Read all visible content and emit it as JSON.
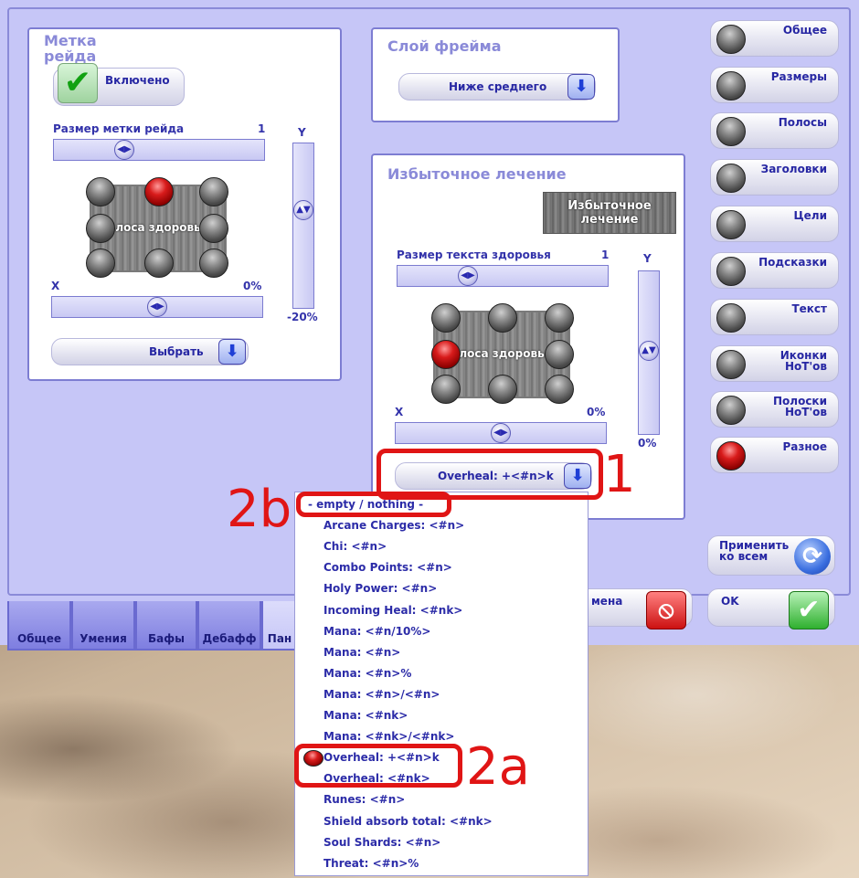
{
  "tabs": [
    "Общее",
    "Умения",
    "Бафы",
    "Дебафф",
    "Пан"
  ],
  "raid_mark": {
    "title": "Метка\nрейда",
    "enabled_label": "Включено",
    "size_label": "Размер метки рейда",
    "size_value": "1",
    "bar_text": "лоса здоровь",
    "x_label": "X",
    "x_value": "0%",
    "y_label": "Y",
    "y_value": "-20%",
    "select_label": "Выбрать"
  },
  "frame_layer": {
    "title": "Слой фрейма",
    "value": "Ниже среднего"
  },
  "overheal": {
    "title": "Избыточное лечение",
    "preview_label": "Избыточное лечение",
    "size_label": "Размер текста здоровья",
    "size_value": "1",
    "bar_text": "лоса здоровь",
    "x_label": "X",
    "x_value": "0%",
    "y_label": "Y",
    "y_value": "0%",
    "format_value": "Overheal: +<#n>k"
  },
  "nav": [
    {
      "label": "Общее",
      "active": false
    },
    {
      "label": "Размеры",
      "active": false
    },
    {
      "label": "Полосы",
      "active": false
    },
    {
      "label": "Заголовки",
      "active": false
    },
    {
      "label": "Цели",
      "active": false
    },
    {
      "label": "Подсказки",
      "active": false
    },
    {
      "label": "Текст",
      "active": false
    },
    {
      "label": "Иконки\nHoT'ов",
      "active": false
    },
    {
      "label": "Полоски\nHoT'ов",
      "active": false
    },
    {
      "label": "Разное",
      "active": true
    }
  ],
  "actions": {
    "apply_all": "Применить\nко всем",
    "cancel": "мена",
    "ok": "OK"
  },
  "dropdown_items": [
    "- empty / nothing -",
    "Arcane Charges: <#n>",
    "Chi: <#n>",
    "Combo Points: <#n>",
    "Holy Power: <#n>",
    "Incoming Heal: <#nk>",
    "Mana: <#n/10%>",
    "Mana: <#n>",
    "Mana: <#n>%",
    "Mana: <#n>/<#n>",
    "Mana: <#nk>",
    "Mana: <#nk>/<#nk>",
    "Overheal: +<#n>k",
    "Overheal: <#nk>",
    "Runes: <#n>",
    "Shield absorb total: <#nk>",
    "Soul Shards: <#n>",
    "Threat: <#n>%"
  ],
  "annotations": {
    "a1": "1",
    "a2a": "2a",
    "a2b": "2b"
  },
  "colors": {
    "window_bg": "#c6c6f7",
    "accent_text": "#2727a3",
    "annotation_red": "#e01515"
  }
}
